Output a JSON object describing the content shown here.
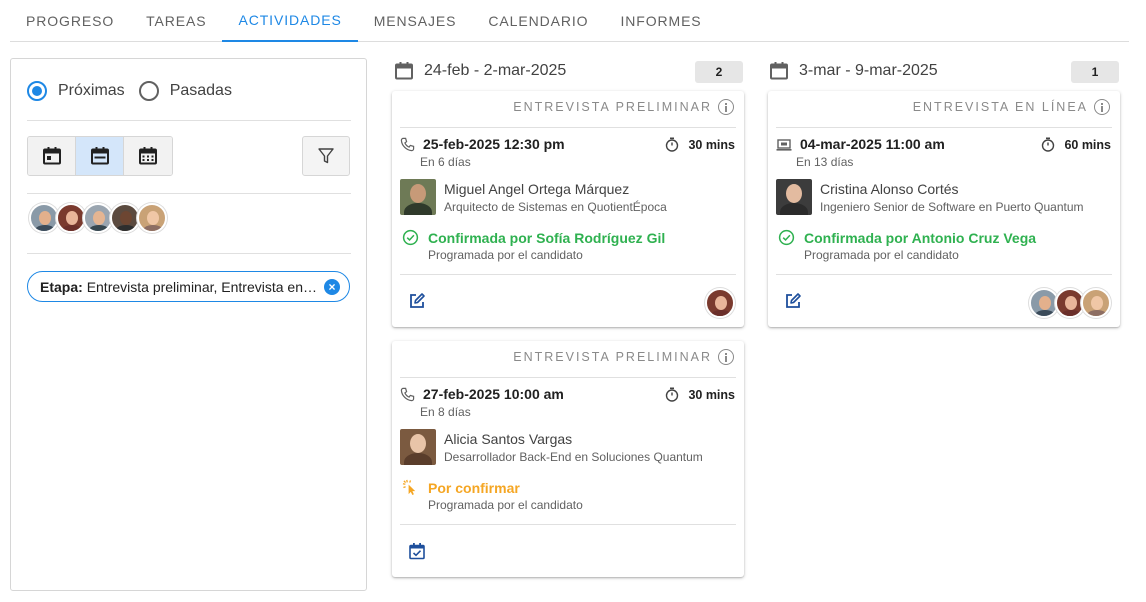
{
  "tabs": [
    "PROGRESO",
    "TAREAS",
    "ACTIVIDADES",
    "MENSAJES",
    "CALENDARIO",
    "INFORMES"
  ],
  "active_tab": "ACTIVIDADES",
  "filters": {
    "radio_upcoming": "Próximas",
    "radio_past": "Pasadas",
    "selected_radio": "Próximas",
    "views": [
      "day-view-icon",
      "week-view-icon",
      "month-view-icon"
    ],
    "active_view": "week-view-icon",
    "chip_label": "Etapa:",
    "chip_value": "Entrevista preliminar, Entrevista en línea"
  },
  "weeks": [
    {
      "range": "24-feb - 2-mar-2025",
      "count": "2"
    },
    {
      "range": "3-mar - 9-mar-2025",
      "count": "1"
    }
  ],
  "cards": [
    {
      "stage": "ENTREVISTA PRELIMINAR",
      "datetime": "25-feb-2025 12:30 pm",
      "type_icon": "phone-icon",
      "duration": "30 mins",
      "relative": "En 6 días",
      "name": "Miguel Angel Ortega Márquez",
      "role": "Arquitecto de Sistemas en QuotientÉpoca",
      "status": "Confirmada por Sofía Rodríguez Gil",
      "status_type": "confirmed",
      "scheduled": "Programada por el candidato",
      "action_icon": "edit-icon"
    },
    {
      "stage": "ENTREVISTA PRELIMINAR",
      "datetime": "27-feb-2025 10:00 am",
      "type_icon": "phone-icon",
      "duration": "30 mins",
      "relative": "En 8 días",
      "name": "Alicia Santos Vargas",
      "role": "Desarrollador Back-End en Soluciones Quantum",
      "status": "Por confirmar",
      "status_type": "pending",
      "scheduled": "Programada por el candidato",
      "action_icon": "calendar-check-icon"
    },
    {
      "stage": "ENTREVISTA EN LÍNEA",
      "datetime": "04-mar-2025 11:00 am",
      "type_icon": "laptop-icon",
      "duration": "60 mins",
      "relative": "En 13 días",
      "name": "Cristina Alonso Cortés",
      "role": "Ingeniero Senior de Software en Puerto Quantum",
      "status": "Confirmada por Antonio Cruz Vega",
      "status_type": "confirmed",
      "scheduled": "Programada por el candidato",
      "action_icon": "edit-icon"
    }
  ],
  "colors": {
    "accent": "#1e88e5",
    "confirmed": "#2fb150",
    "pending": "#f5a623"
  }
}
